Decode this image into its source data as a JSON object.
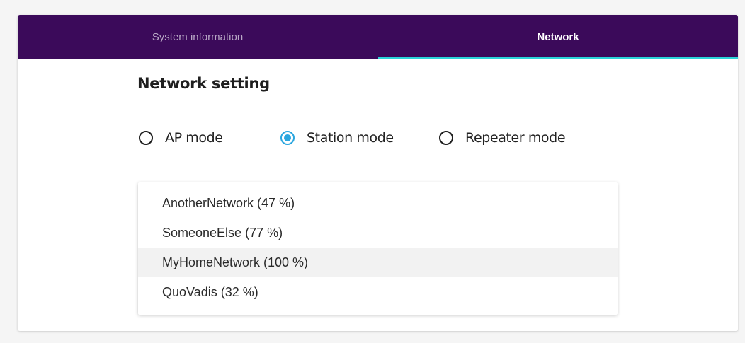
{
  "tabs": [
    {
      "label": "System information",
      "active": false
    },
    {
      "label": "Network",
      "active": true
    }
  ],
  "section": {
    "title": "Network setting"
  },
  "modes": [
    {
      "label": "AP mode",
      "checked": false
    },
    {
      "label": "Station mode",
      "checked": true
    },
    {
      "label": "Repeater mode",
      "checked": false
    }
  ],
  "networks": [
    {
      "label": "AnotherNetwork (47 %)",
      "highlighted": false
    },
    {
      "label": "SomeoneElse (77 %)",
      "highlighted": false
    },
    {
      "label": "MyHomeNetwork (100 %)",
      "highlighted": true
    },
    {
      "label": "QuoVadis (32 %)",
      "highlighted": false
    }
  ],
  "colors": {
    "tabbar_bg": "#3b0a5a",
    "tab_indicator": "#2bd4d8",
    "radio_accent": "#2aa6df",
    "highlight_bg": "#f2f2f2"
  }
}
